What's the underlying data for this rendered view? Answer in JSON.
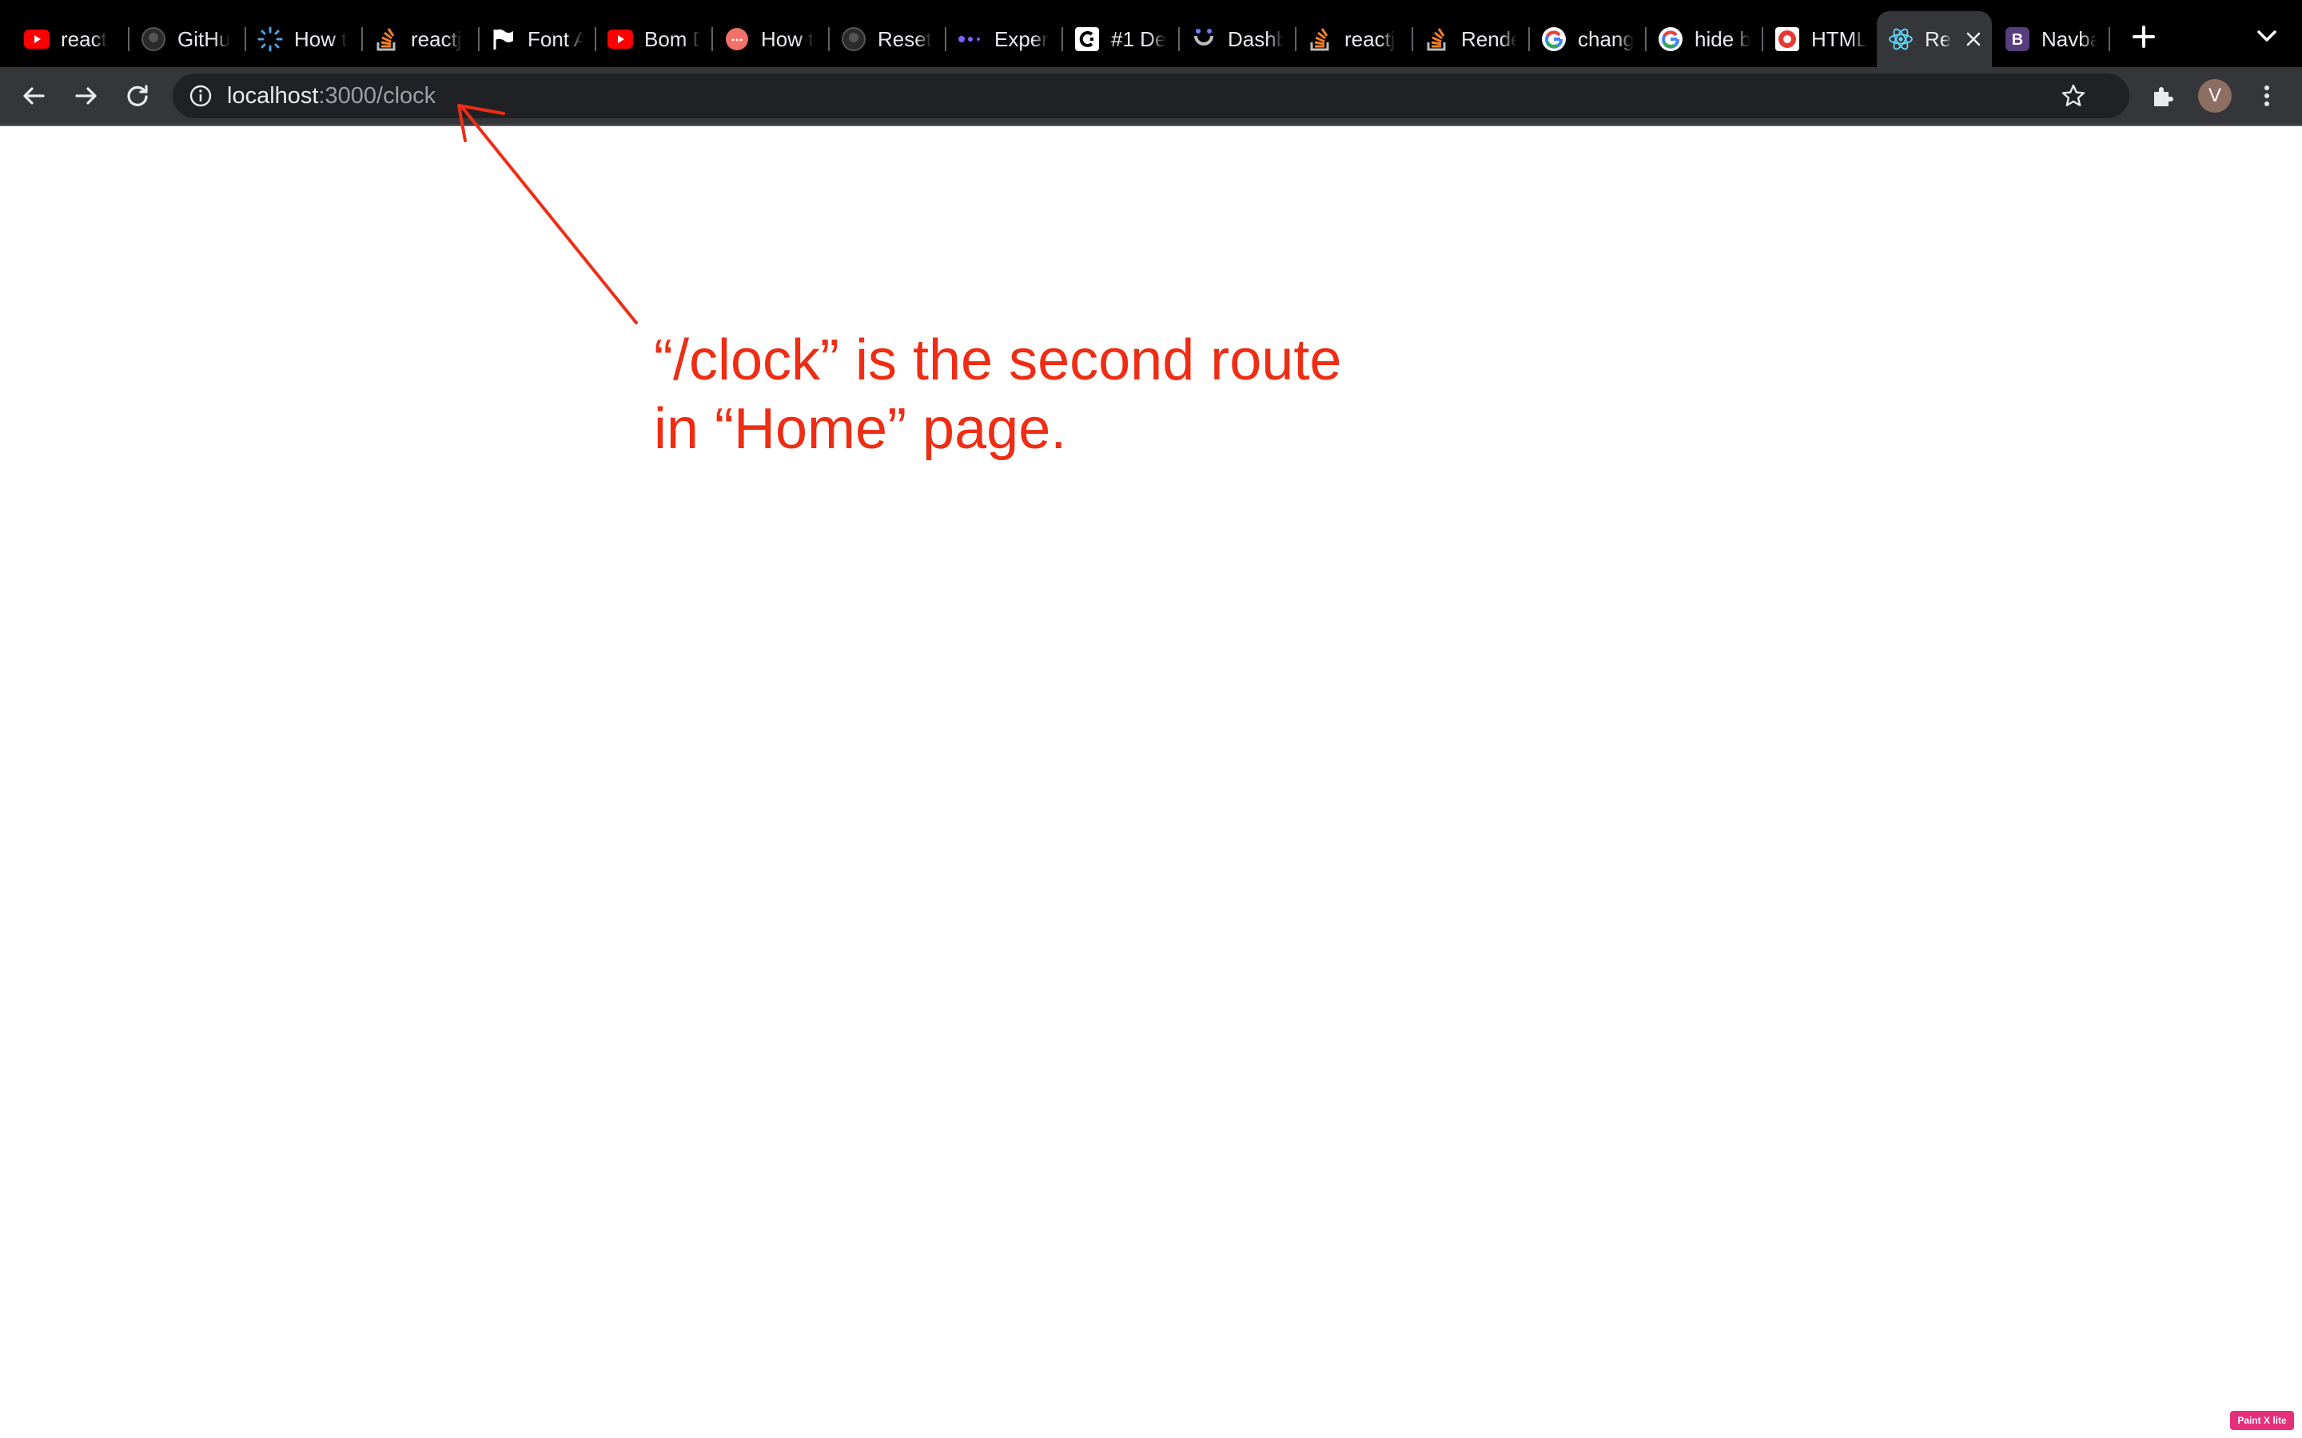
{
  "tabs": [
    {
      "title": "react",
      "icon": "youtube-icon"
    },
    {
      "title": "GitHu",
      "icon": "github-icon"
    },
    {
      "title": "How t",
      "icon": "spinner-icon"
    },
    {
      "title": "reactj",
      "icon": "stackoverflow-icon"
    },
    {
      "title": "Font A",
      "icon": "flag-icon"
    },
    {
      "title": "Bom D",
      "icon": "youtube-icon"
    },
    {
      "title": "How t",
      "icon": "circle-icon"
    },
    {
      "title": "Reset",
      "icon": "github-icon"
    },
    {
      "title": "Exper",
      "icon": "dots-icon"
    },
    {
      "title": "#1 De",
      "icon": "c-logo-icon"
    },
    {
      "title": "Dashb",
      "icon": "arc-icon"
    },
    {
      "title": "reactj",
      "icon": "stackoverflow-icon"
    },
    {
      "title": "Rende",
      "icon": "stackoverflow-icon"
    },
    {
      "title": "chang",
      "icon": "google-icon"
    },
    {
      "title": "hide b",
      "icon": "google-icon"
    },
    {
      "title": "HTML",
      "icon": "red-circle-icon"
    },
    {
      "title": "Re",
      "icon": "react-icon",
      "active": true
    },
    {
      "title": "Navba",
      "icon": "bootstrap-icon"
    }
  ],
  "address_bar": {
    "host": "localhost",
    "path": ":3000/clock"
  },
  "profile": {
    "initial": "V"
  },
  "annotation": {
    "line1": "“/clock” is the second route",
    "line2": "in “Home” page.",
    "color": "#ee2d14"
  },
  "watermark": {
    "text": "Paint X lite"
  },
  "colors": {
    "tabstrip_bg": "#000000",
    "toolbar_bg": "#35363a",
    "omnibox_bg": "#202124",
    "active_tab_bg": "#35363a",
    "annotation": "#ee2d14"
  }
}
